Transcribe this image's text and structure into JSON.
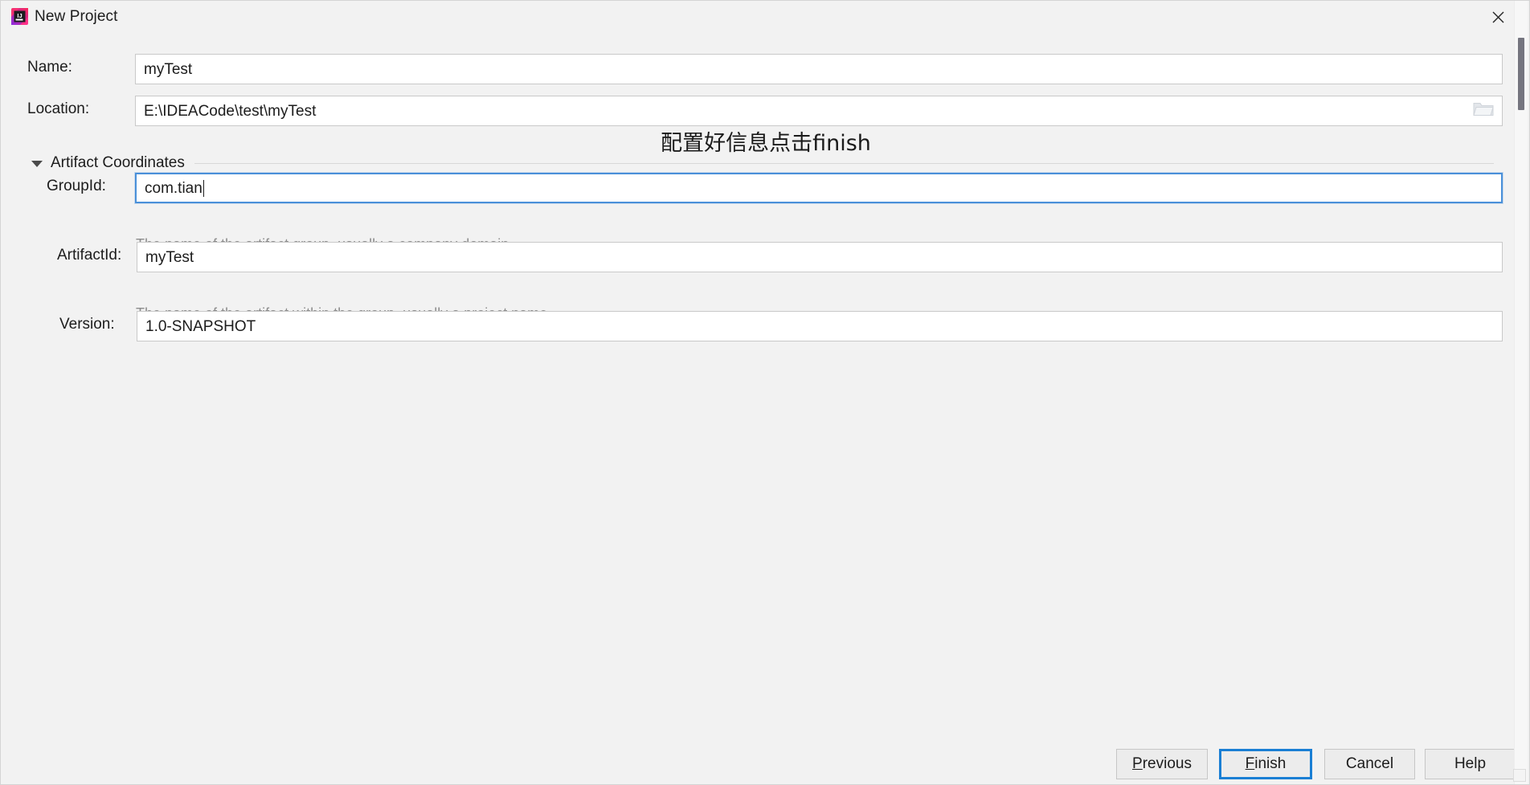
{
  "window": {
    "title": "New Project",
    "app_icon": "intellij-idea-icon",
    "close_icon": "close-icon"
  },
  "form": {
    "name": {
      "label": "Name:",
      "value": "myTest",
      "placeholder": ""
    },
    "location": {
      "label": "Location:",
      "value": "E:\\IDEACode\\test\\myTest",
      "placeholder": "",
      "browse_icon": "folder-icon"
    }
  },
  "annotation": {
    "text": "配置好信息点击finish"
  },
  "section": {
    "title": "Artifact Coordinates",
    "expanded": true,
    "collapse_icon": "triangle-down-icon"
  },
  "coordinates": {
    "group_id": {
      "label": "GroupId:",
      "value": "com.tian",
      "hint": "The name of the artifact group, usually a company domain",
      "focused": true
    },
    "artifact_id": {
      "label": "ArtifactId:",
      "value": "myTest",
      "hint": "The name of the artifact within the group, usually a project name",
      "focused": false
    },
    "version": {
      "label": "Version:",
      "value": "1.0-SNAPSHOT",
      "hint": "",
      "focused": false
    }
  },
  "buttons": {
    "previous": {
      "label": "Previous",
      "mnemonic": "P",
      "rest": "revious",
      "default": false
    },
    "finish": {
      "label": "Finish",
      "mnemonic": "F",
      "rest": "inish",
      "default": true
    },
    "cancel": {
      "label": "Cancel",
      "mnemonic": "",
      "rest": "Cancel",
      "default": false
    },
    "help": {
      "label": "Help",
      "mnemonic": "",
      "rest": "Help",
      "default": false
    }
  },
  "colors": {
    "background": "#f2f2f2",
    "focus_border": "#4a90d9",
    "default_button_border": "#1a7fd4",
    "hint_text": "#8c8c8c",
    "scrollbar_thumb": "#75757f"
  }
}
